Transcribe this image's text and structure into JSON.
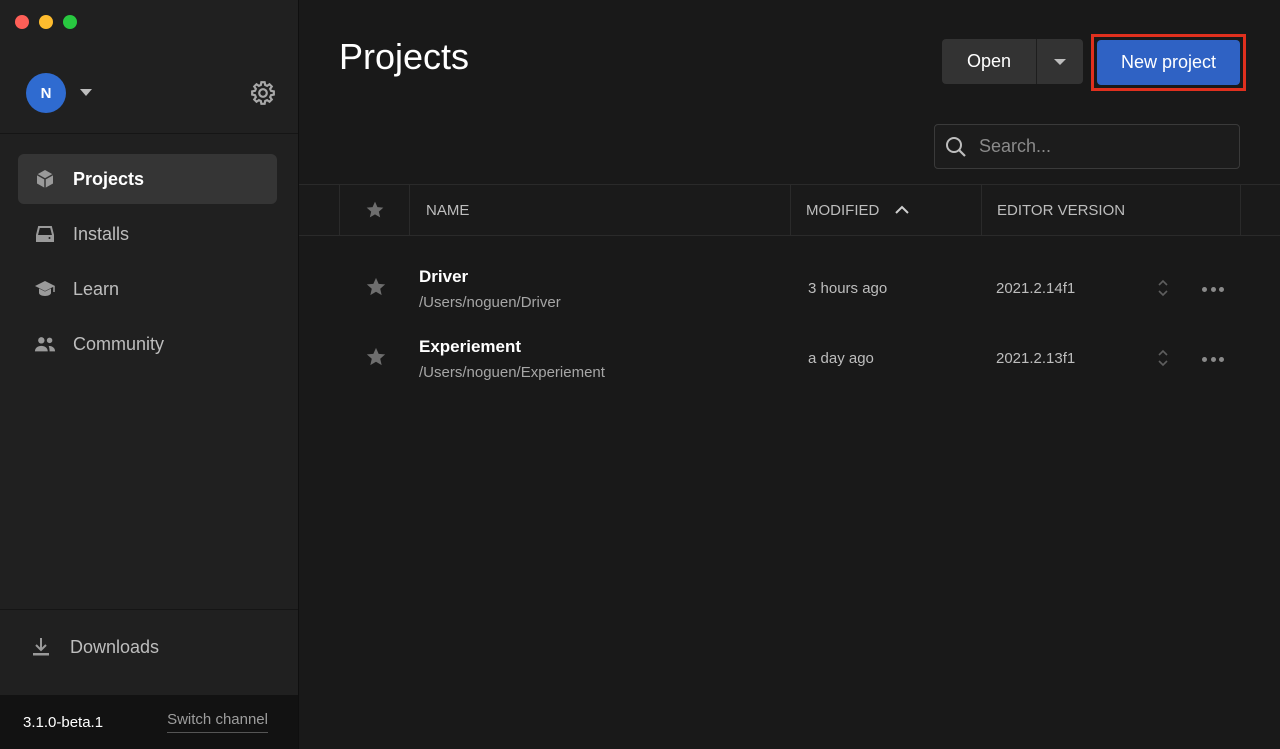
{
  "window": {
    "controls": [
      "close",
      "minimize",
      "maximize"
    ]
  },
  "user": {
    "initial": "N",
    "avatar_color": "#2f6bd0"
  },
  "sidebar": {
    "items": [
      {
        "label": "Projects",
        "icon": "cube-icon",
        "active": true
      },
      {
        "label": "Installs",
        "icon": "drive-icon",
        "active": false
      },
      {
        "label": "Learn",
        "icon": "graduation-cap-icon",
        "active": false
      },
      {
        "label": "Community",
        "icon": "people-icon",
        "active": false
      }
    ],
    "downloads_label": "Downloads",
    "version": "3.1.0-beta.1",
    "switch_channel": "Switch channel"
  },
  "main": {
    "title": "Projects",
    "open_label": "Open",
    "new_project_label": "New project",
    "search_placeholder": "Search...",
    "columns": {
      "name": "NAME",
      "modified": "MODIFIED",
      "editor_version": "EDITOR VERSION"
    },
    "sort": {
      "column": "modified",
      "direction": "ascending"
    },
    "projects": [
      {
        "name": "Driver",
        "path": "/Users/noguen/Driver",
        "modified": "3 hours ago",
        "editor_version": "2021.2.14f1"
      },
      {
        "name": "Experiement",
        "path": "/Users/noguen/Experiement",
        "modified": "a day ago",
        "editor_version": "2021.2.13f1"
      }
    ]
  },
  "colors": {
    "accent": "#2f62c4",
    "highlight_border": "#e0301e",
    "background": "#191919",
    "sidebar": "#202020"
  }
}
